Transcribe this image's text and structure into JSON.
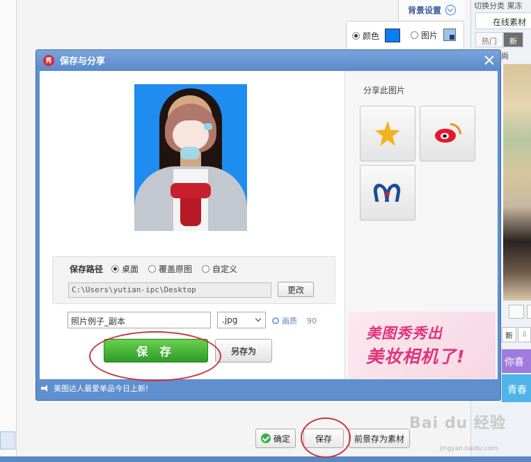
{
  "background": {
    "bg_settings_tab": "背景设置",
    "bg_color_label": "颜色",
    "bg_picture_label": "图片",
    "bg_color": "#0a7cf4",
    "right_panel": {
      "top_text": "切换分类",
      "top_text_2": "果冻",
      "online_tab": "在线素材",
      "hot_tab": "热门",
      "new_tab": "新",
      "fashion_tab": "时尚",
      "btn_new": "新",
      "banner_1": "你喜",
      "banner_2": "青春"
    },
    "bottom": {
      "confirm_label": "确定",
      "save_label": "保存",
      "save_fg_label": "前景存为素材"
    },
    "watermark": "Bai du 经验",
    "watermark_sub": "jingyan.baidu.com"
  },
  "dialog": {
    "title": "保存与分享",
    "logo_char": "秀",
    "save_path": {
      "label": "保存路径",
      "options": [
        "桌面",
        "覆盖原图",
        "自定义"
      ],
      "selected_index": 0,
      "path_value": "C:\\Users\\yutian-ipc\\Desktop",
      "change_button": "更改"
    },
    "file_name": "照片例子_副本",
    "extension": ".jpg",
    "quality_label": "画质",
    "quality_value": "90",
    "save_button": "保 存",
    "save_as_button": "另存为",
    "share": {
      "label": "分享此图片",
      "targets": [
        "qzone-icon",
        "weibo-icon",
        "renren-icon"
      ]
    },
    "ad": {
      "line1": "美图秀秀出",
      "line2": "美妆相机了!"
    },
    "status_text": "美图达人最爱单品今日上新!"
  },
  "colors": {
    "titlebar": "#5b8bcb",
    "save_green": "#2e9c28",
    "annotation_red": "#d0323f"
  }
}
